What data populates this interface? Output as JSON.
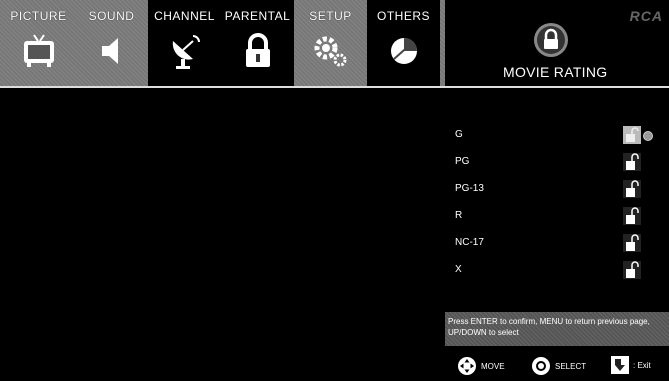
{
  "menu": {
    "tabs": [
      {
        "label": "PICTURE",
        "icon": "tv-icon"
      },
      {
        "label": "SOUND",
        "icon": "speaker-icon"
      },
      {
        "label": "CHANNEL",
        "icon": "satellite-dish-icon"
      },
      {
        "label": "PARENTAL",
        "icon": "padlock-icon"
      },
      {
        "label": "SETUP",
        "icon": "gears-icon"
      },
      {
        "label": "OTHERS",
        "icon": "pie-icon"
      }
    ],
    "active_tab": "PARENTAL"
  },
  "brand": "RCA",
  "panel": {
    "title": "MOVIE RATING",
    "icon": "lock-badge-icon"
  },
  "ratings": [
    {
      "label": "G",
      "locked": false,
      "selected": true
    },
    {
      "label": "PG",
      "locked": false,
      "selected": false
    },
    {
      "label": "PG-13",
      "locked": false,
      "selected": false
    },
    {
      "label": "R",
      "locked": false,
      "selected": false
    },
    {
      "label": "NC-17",
      "locked": false,
      "selected": false
    },
    {
      "label": "X",
      "locked": false,
      "selected": false
    }
  ],
  "help_text": "Press ENTER to confirm, MENU to return previous page, UP/DOWN to select",
  "footer": {
    "move": "MOVE",
    "select": "SELECT",
    "exit": ": Exit"
  },
  "colors": {
    "menu_bg": "#777777",
    "background": "#000000",
    "text": "#ffffff"
  }
}
